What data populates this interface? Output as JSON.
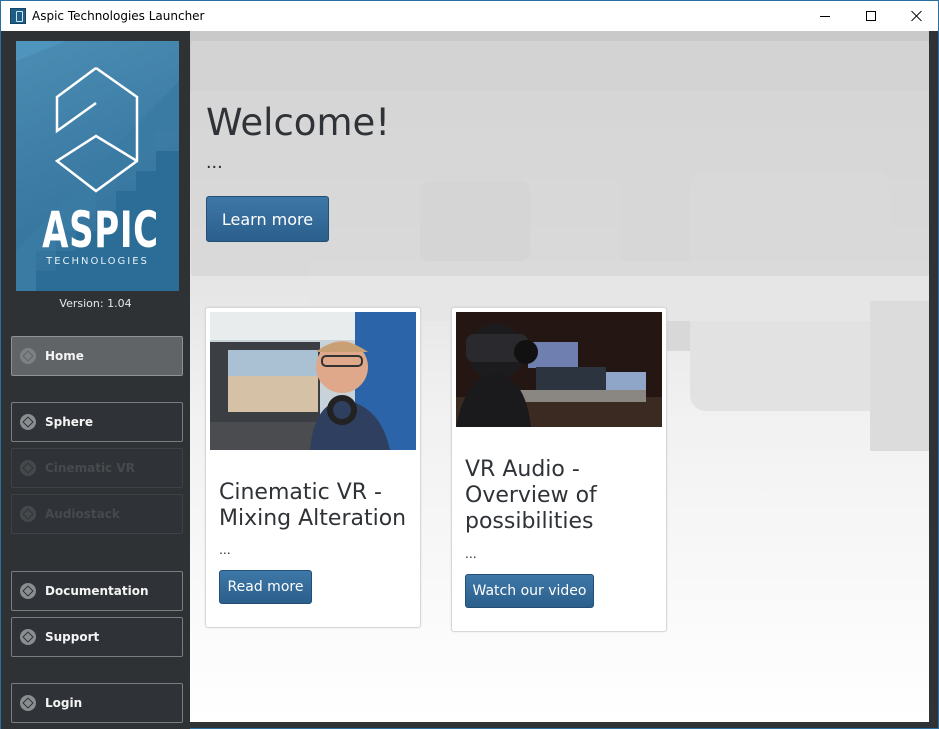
{
  "window": {
    "title": "Aspic Technologies Launcher"
  },
  "sidebar": {
    "logo_word": "ASPIC",
    "logo_sub": "TECHNOLOGIES",
    "version": "Version: 1.04",
    "items": [
      {
        "label": "Home",
        "icon": "diamond-icon",
        "state": "active"
      },
      {
        "label": "Sphere",
        "icon": "diamond-icon",
        "state": "enabled"
      },
      {
        "label": "Cinematic VR",
        "icon": "diamond-icon",
        "state": "disabled"
      },
      {
        "label": "Audiostack",
        "icon": "diamond-icon",
        "state": "disabled"
      },
      {
        "label": "Documentation",
        "icon": "diamond-icon",
        "state": "enabled"
      },
      {
        "label": "Support",
        "icon": "diamond-icon",
        "state": "enabled"
      },
      {
        "label": "Login",
        "icon": "diamond-icon",
        "state": "enabled"
      }
    ]
  },
  "hero": {
    "title": "Welcome!",
    "subtitle": "...",
    "button": "Learn more"
  },
  "cards": [
    {
      "title": "Cinematic VR - Mixing Alteration",
      "dots": "...",
      "button": "Read more"
    },
    {
      "title": "VR Audio - Overview of possibilities",
      "dots": "...",
      "button": "Watch our video"
    }
  ],
  "colors": {
    "accent": "#2e6594",
    "sidebar": "#2e3235",
    "logo": "#3f7fa7"
  }
}
